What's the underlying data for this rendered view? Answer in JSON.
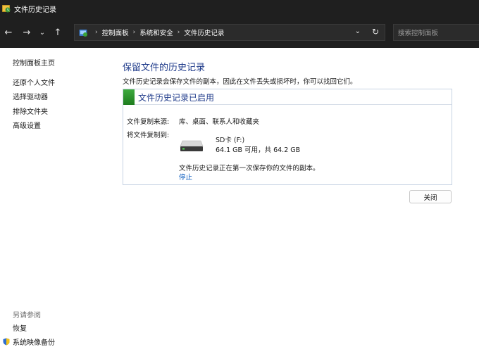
{
  "window": {
    "title": "文件历史记录"
  },
  "nav": {
    "back_icon": "arrow-left-icon",
    "forward_icon": "arrow-right-icon",
    "recent_icon": "chevron-down-icon",
    "up_icon": "arrow-up-icon",
    "breadcrumbs": [
      "控制面板",
      "系统和安全",
      "文件历史记录"
    ],
    "search_placeholder": "搜索控制面板"
  },
  "sidebar": {
    "home": "控制面板主页",
    "items": [
      "还原个人文件",
      "选择驱动器",
      "排除文件夹",
      "高级设置"
    ],
    "see_also_title": "另请参阅",
    "see_also": [
      "恢复",
      "系统映像备份"
    ]
  },
  "main": {
    "title": "保留文件的历史记录",
    "subtitle": "文件历史记录会保存文件的副本，因此在文件丢失或损坏时，你可以找回它们。",
    "status_title": "文件历史记录已启用",
    "source_label": "文件复制来源:",
    "source_value": "库、桌面、联系人和收藏夹",
    "dest_label": "将文件复制到:",
    "drive_name": "SD卡 (F:)",
    "drive_space": "64.1 GB 可用，共 64.2 GB",
    "progress_message": "文件历史记录正在第一次保存你的文件的副本。",
    "stop_link": "停止",
    "close_button": "关闭"
  },
  "colors": {
    "title_blue": "#1e3a8a",
    "link_blue": "#0a5bbf",
    "status_green": "#2e8b2e",
    "chrome_dark": "#1f1f1f"
  }
}
